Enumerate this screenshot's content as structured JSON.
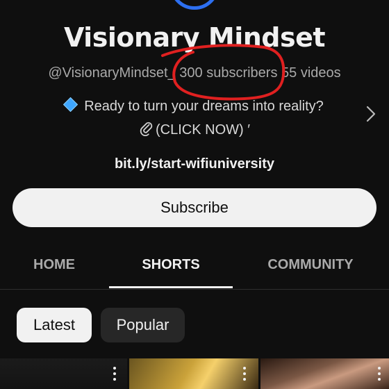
{
  "channel": {
    "name": "Visionary Mindset",
    "handle": "@VisionaryMindset_",
    "subscribers": "300 subscribers",
    "videos": "55 videos",
    "description_line1": "Ready to turn your dreams into reality?",
    "description_line2": "(CLICK NOW) ′",
    "link": "bit.ly/start-wifiuniversity"
  },
  "actions": {
    "subscribe_label": "Subscribe"
  },
  "tabs": [
    {
      "label": "HOME",
      "active": false
    },
    {
      "label": "SHORTS",
      "active": true
    },
    {
      "label": "COMMUNITY",
      "active": false
    }
  ],
  "chips": [
    {
      "label": "Latest",
      "selected": true
    },
    {
      "label": "Popular",
      "selected": false
    }
  ],
  "icons": {
    "description_bullet": "blue-diamond-icon",
    "clip": "paperclip-icon",
    "expand": "chevron-right-icon",
    "more": "more-vert-icon"
  },
  "colors": {
    "background": "#0f0f0f",
    "avatar_ring": "#2d6ff0",
    "annotation": "#e02020",
    "subscribe_bg": "#f1f1f1"
  }
}
